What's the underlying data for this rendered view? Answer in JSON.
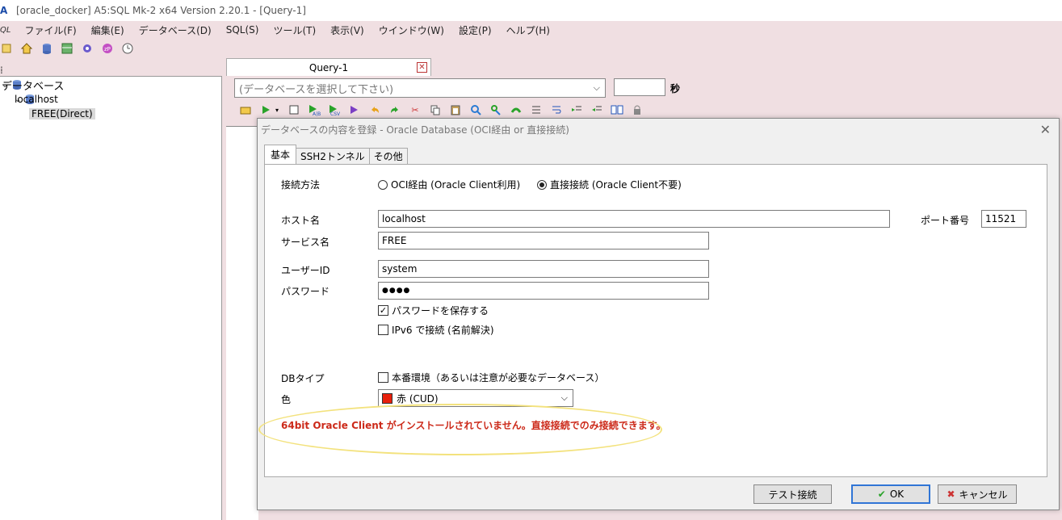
{
  "window": {
    "title": "[oracle_docker] A5:SQL Mk-2 x64 Version 2.20.1 - [Query-1]"
  },
  "menu": {
    "ql": "QL",
    "items": [
      "ファイル(F)",
      "編集(E)",
      "データベース(D)",
      "SQL(S)",
      "ツール(T)",
      "表示(V)",
      "ウインドウ(W)",
      "設定(P)",
      "ヘルプ(H)"
    ]
  },
  "tree": {
    "root": "データベース",
    "host": "localhost",
    "db": "FREE(Direct)"
  },
  "query": {
    "tab_label": "Query-1",
    "db_select_placeholder": "(データベースを選択して下さい)",
    "seconds_label": "秒"
  },
  "dialog": {
    "title": "データベースの内容を登録 - Oracle Database (OCI経由 or 直接接続)",
    "tabs": [
      "基本",
      "SSH2トンネル",
      "その他"
    ],
    "connection_method_label": "接続方法",
    "radio_oci": "OCI経由 (Oracle Client利用)",
    "radio_direct": "直接接続 (Oracle Client不要)",
    "host_label": "ホスト名",
    "host_value": "localhost",
    "port_label": "ポート番号",
    "port_value": "11521",
    "service_label": "サービス名",
    "service_value": "FREE",
    "user_label": "ユーザーID",
    "user_value": "system",
    "password_label": "パスワード",
    "password_value": "●●●●",
    "save_password": "パスワードを保存する",
    "ipv6": "IPv6 で接続 (名前解決)",
    "dbtype_label": "DBタイプ",
    "production": "本番環境（あるいは注意が必要なデータベース）",
    "color_label": "色",
    "color_value": "赤 (CUD)",
    "warning": "64bit Oracle Client がインストールされていません。直接接続でのみ接続できます。",
    "test_button": "テスト接続",
    "ok_button": "OK",
    "cancel_button": "キャンセル"
  },
  "colors": {
    "swatch": "#e8200c",
    "warning": "#cc2a1a",
    "chrome": "#f0dfe2"
  }
}
